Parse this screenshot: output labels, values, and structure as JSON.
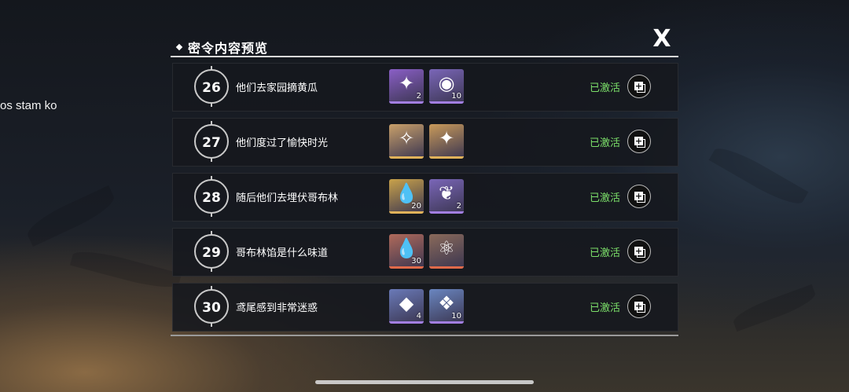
{
  "side_text": "os stam ko",
  "panel": {
    "title": "密令内容预览",
    "close_glyph": "X"
  },
  "rows": [
    {
      "number": "26",
      "title": "他们去家园摘黄瓜",
      "status": "已激活",
      "items": [
        {
          "icon": "purple-puzzle-icon",
          "count": "2",
          "tint": "#8a5fc6",
          "bar": "#a27ee0",
          "glyph": "✦"
        },
        {
          "icon": "crystal-orb-icon",
          "count": "10",
          "tint": "#7a66b8",
          "bar": "#a27ee0",
          "glyph": "◉"
        }
      ]
    },
    {
      "number": "27",
      "title": "他们度过了愉快时光",
      "status": "已激活",
      "items": [
        {
          "icon": "pink-star-card-icon",
          "count": "",
          "tint": "#c9a06a",
          "bar": "#e0b25a",
          "glyph": "✧"
        },
        {
          "icon": "gold-puzzle-icon",
          "count": "",
          "tint": "#c99a5a",
          "bar": "#e0b25a",
          "glyph": "✦"
        }
      ]
    },
    {
      "number": "28",
      "title": "随后他们去埋伏哥布林",
      "status": "已激活",
      "items": [
        {
          "icon": "gold-drop-icon",
          "count": "20",
          "tint": "#c9a24a",
          "bar": "#e0b25a",
          "glyph": "💧"
        },
        {
          "icon": "feather-leaf-icon",
          "count": "2",
          "tint": "#7a66b8",
          "bar": "#a27ee0",
          "glyph": "❦"
        }
      ]
    },
    {
      "number": "29",
      "title": "哥布林馅是什么味道",
      "status": "已激活",
      "items": [
        {
          "icon": "rainbow-drop-icon",
          "count": "30",
          "tint": "#b06a5a",
          "bar": "#e06a4a",
          "glyph": "💧"
        },
        {
          "icon": "atom-orb-icon",
          "count": "",
          "tint": "#8a6a5a",
          "bar": "#e06a4a",
          "glyph": "⚛"
        }
      ]
    },
    {
      "number": "30",
      "title": "鸢尾感到非常迷惑",
      "status": "已激活",
      "items": [
        {
          "icon": "blue-crystal-icon",
          "count": "4",
          "tint": "#6a7ab8",
          "bar": "#a27ee0",
          "glyph": "◆"
        },
        {
          "icon": "ice-crystal-icon",
          "count": "10",
          "tint": "#6a86c0",
          "bar": "#a27ee0",
          "glyph": "❖"
        }
      ]
    }
  ]
}
